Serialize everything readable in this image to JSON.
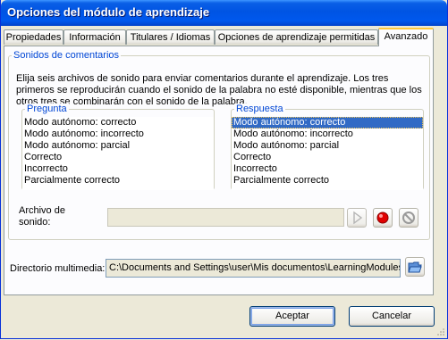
{
  "window": {
    "title": "Opciones del módulo de aprendizaje"
  },
  "tabs": [
    {
      "label": "Propiedades"
    },
    {
      "label": "Información"
    },
    {
      "label": "Titulares / Idiomas"
    },
    {
      "label": "Opciones de aprendizaje permitidas"
    },
    {
      "label": "Avanzado"
    }
  ],
  "sounds": {
    "group_title": "Sonidos de comentarios",
    "description": "Elija seis archivos de sonido para enviar comentarios durante el aprendizaje. Los tres primeros se reproducirán cuando el sonido de la palabra no esté disponible, mientras que los otros tres se combinarán con el sonido de la palabra.",
    "question": {
      "title": "Pregunta",
      "items": [
        "Modo autónomo: correcto",
        "Modo autónomo: incorrecto",
        "Modo autónomo: parcial",
        "Correcto",
        "Incorrecto",
        "Parcialmente correcto"
      ]
    },
    "answer": {
      "title": "Respuesta",
      "items": [
        "Modo autónomo: correcto",
        "Modo autónomo: incorrecto",
        "Modo autónomo: parcial",
        "Correcto",
        "Incorrecto",
        "Parcialmente correcto"
      ],
      "selected_index": 0
    },
    "file_label_line1": "Archivo de",
    "file_label_line2": "sonido:",
    "file_value": ""
  },
  "media": {
    "label": "Directorio multimedia:",
    "value": "C:\\Documents and Settings\\user\\Mis documentos\\LearningModules\\"
  },
  "buttons": {
    "accept": "Aceptar",
    "cancel": "Cancelar"
  },
  "colors": {
    "title_bar": "#0054e3",
    "selection": "#316ac5",
    "group_title": "#0046d5",
    "record": "#e00000"
  }
}
